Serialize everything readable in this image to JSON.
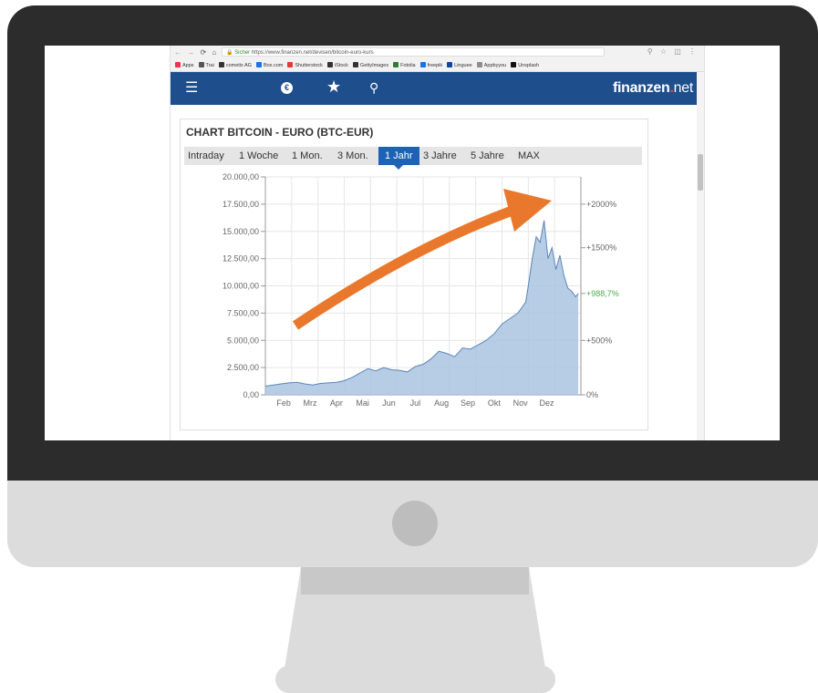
{
  "browser": {
    "secure_label": "Sicher",
    "url": "https://www.finanzen.net/devisen/bitcoin-euro-kurs",
    "bookmarks": [
      "Apps",
      "Trai",
      "cometix AG",
      "Box.com",
      "Shutterstock",
      "iStock",
      "GettyImages",
      "Fotolia",
      "freepik",
      "Linguee",
      "Appbyyou",
      "Unsplash"
    ]
  },
  "site": {
    "brand_main": "finanzen",
    "brand_dot": ".",
    "brand_suffix": "net"
  },
  "colors": {
    "header_bg": "#1e4f8c",
    "active_tab": "#1e62b5",
    "series_fill": "#a9c4e0",
    "series_line": "#5b85b6",
    "arrow": "#e9782c",
    "last_value": "#4caf50"
  },
  "chart": {
    "title": "CHART BITCOIN - EURO (BTC-EUR)",
    "tabs": [
      "Intraday",
      "1 Woche",
      "1 Mon.",
      "3 Mon.",
      "1 Jahr",
      "3 Jahre",
      "5 Jahre",
      "MAX"
    ],
    "active_tab": "1 Jahr"
  },
  "chart_data": {
    "type": "area",
    "title": "CHART BITCOIN - EURO (BTC-EUR)",
    "x_labels": [
      "Feb",
      "Mrz",
      "Apr",
      "Mai",
      "Jun",
      "Jul",
      "Aug",
      "Sep",
      "Okt",
      "Nov",
      "Dez"
    ],
    "y_left_ticks": [
      "0,00",
      "2.500,00",
      "5.000,00",
      "7.500,00",
      "10.000,00",
      "12.500,00",
      "15.000,00",
      "17.500,00",
      "20.000,00"
    ],
    "y_right_ticks": [
      "0%",
      "+500%",
      "+1500%",
      "+2000%"
    ],
    "last_value_label": "+988,7%",
    "ylim": [
      0,
      20000
    ],
    "grid": true,
    "series": [
      {
        "x": [
          0.0,
          0.3,
          0.6,
          0.9,
          1.2,
          1.5,
          1.8,
          2.1,
          2.4,
          2.7,
          3.0,
          3.3,
          3.6,
          3.9,
          4.2,
          4.5,
          4.8,
          5.1,
          5.4,
          5.7,
          6.0,
          6.3,
          6.6,
          6.9,
          7.2,
          7.5,
          7.8,
          8.1,
          8.4,
          8.7,
          9.0,
          9.3,
          9.6,
          9.9,
          10.0,
          10.15,
          10.3,
          10.45,
          10.6,
          10.75,
          10.9,
          11.05,
          11.2,
          11.35,
          11.5,
          11.65,
          11.8,
          11.9
        ],
        "values": [
          800,
          900,
          1000,
          1100,
          1150,
          1000,
          900,
          1050,
          1100,
          1150,
          1300,
          1600,
          2000,
          2400,
          2200,
          2500,
          2300,
          2250,
          2100,
          2600,
          2800,
          3300,
          4000,
          3800,
          3500,
          4300,
          4200,
          4600,
          5000,
          5600,
          6500,
          7000,
          7500,
          8500,
          10000,
          12500,
          14500,
          14000,
          16000,
          12500,
          13500,
          11500,
          12800,
          11000,
          9800,
          9500,
          9000,
          9300
        ]
      }
    ]
  }
}
